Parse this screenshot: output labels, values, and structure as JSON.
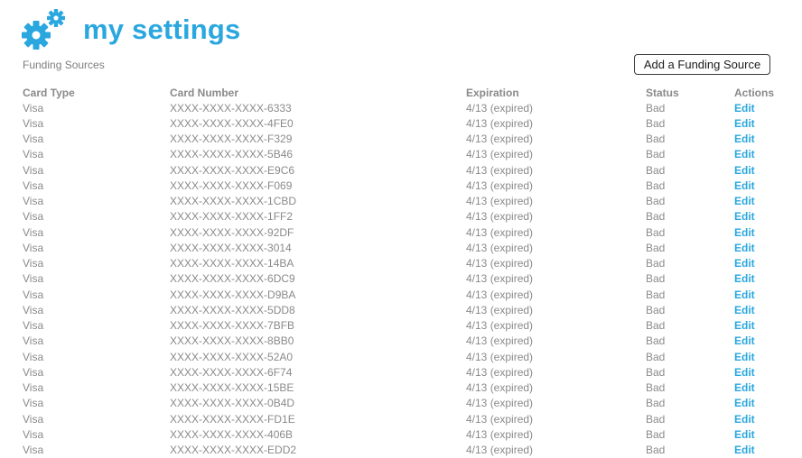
{
  "header": {
    "title": "my settings",
    "subtitle": "Funding Sources",
    "logo_icon": "gears-icon"
  },
  "toolbar": {
    "add_label": "Add a Funding Source"
  },
  "table": {
    "columns": [
      "Card Type",
      "Card Number",
      "Expiration",
      "Status",
      "Actions"
    ],
    "rows": [
      {
        "type": "Visa",
        "number": "XXXX-XXXX-XXXX-6333",
        "expiration": "4/13 (expired)",
        "status": "Bad",
        "action": "Edit"
      },
      {
        "type": "Visa",
        "number": "XXXX-XXXX-XXXX-4FE0",
        "expiration": "4/13 (expired)",
        "status": "Bad",
        "action": "Edit"
      },
      {
        "type": "Visa",
        "number": "XXXX-XXXX-XXXX-F329",
        "expiration": "4/13 (expired)",
        "status": "Bad",
        "action": "Edit"
      },
      {
        "type": "Visa",
        "number": "XXXX-XXXX-XXXX-5B46",
        "expiration": "4/13 (expired)",
        "status": "Bad",
        "action": "Edit"
      },
      {
        "type": "Visa",
        "number": "XXXX-XXXX-XXXX-E9C6",
        "expiration": "4/13 (expired)",
        "status": "Bad",
        "action": "Edit"
      },
      {
        "type": "Visa",
        "number": "XXXX-XXXX-XXXX-F069",
        "expiration": "4/13 (expired)",
        "status": "Bad",
        "action": "Edit"
      },
      {
        "type": "Visa",
        "number": "XXXX-XXXX-XXXX-1CBD",
        "expiration": "4/13 (expired)",
        "status": "Bad",
        "action": "Edit"
      },
      {
        "type": "Visa",
        "number": "XXXX-XXXX-XXXX-1FF2",
        "expiration": "4/13 (expired)",
        "status": "Bad",
        "action": "Edit"
      },
      {
        "type": "Visa",
        "number": "XXXX-XXXX-XXXX-92DF",
        "expiration": "4/13 (expired)",
        "status": "Bad",
        "action": "Edit"
      },
      {
        "type": "Visa",
        "number": "XXXX-XXXX-XXXX-3014",
        "expiration": "4/13 (expired)",
        "status": "Bad",
        "action": "Edit"
      },
      {
        "type": "Visa",
        "number": "XXXX-XXXX-XXXX-14BA",
        "expiration": "4/13 (expired)",
        "status": "Bad",
        "action": "Edit"
      },
      {
        "type": "Visa",
        "number": "XXXX-XXXX-XXXX-6DC9",
        "expiration": "4/13 (expired)",
        "status": "Bad",
        "action": "Edit"
      },
      {
        "type": "Visa",
        "number": "XXXX-XXXX-XXXX-D9BA",
        "expiration": "4/13 (expired)",
        "status": "Bad",
        "action": "Edit"
      },
      {
        "type": "Visa",
        "number": "XXXX-XXXX-XXXX-5DD8",
        "expiration": "4/13 (expired)",
        "status": "Bad",
        "action": "Edit"
      },
      {
        "type": "Visa",
        "number": "XXXX-XXXX-XXXX-7BFB",
        "expiration": "4/13 (expired)",
        "status": "Bad",
        "action": "Edit"
      },
      {
        "type": "Visa",
        "number": "XXXX-XXXX-XXXX-8BB0",
        "expiration": "4/13 (expired)",
        "status": "Bad",
        "action": "Edit"
      },
      {
        "type": "Visa",
        "number": "XXXX-XXXX-XXXX-52A0",
        "expiration": "4/13 (expired)",
        "status": "Bad",
        "action": "Edit"
      },
      {
        "type": "Visa",
        "number": "XXXX-XXXX-XXXX-6F74",
        "expiration": "4/13 (expired)",
        "status": "Bad",
        "action": "Edit"
      },
      {
        "type": "Visa",
        "number": "XXXX-XXXX-XXXX-15BE",
        "expiration": "4/13 (expired)",
        "status": "Bad",
        "action": "Edit"
      },
      {
        "type": "Visa",
        "number": "XXXX-XXXX-XXXX-0B4D",
        "expiration": "4/13 (expired)",
        "status": "Bad",
        "action": "Edit"
      },
      {
        "type": "Visa",
        "number": "XXXX-XXXX-XXXX-FD1E",
        "expiration": "4/13 (expired)",
        "status": "Bad",
        "action": "Edit"
      },
      {
        "type": "Visa",
        "number": "XXXX-XXXX-XXXX-406B",
        "expiration": "4/13 (expired)",
        "status": "Bad",
        "action": "Edit"
      },
      {
        "type": "Visa",
        "number": "XXXX-XXXX-XXXX-EDD2",
        "expiration": "4/13 (expired)",
        "status": "Bad",
        "action": "Edit"
      }
    ]
  },
  "colors": {
    "accent": "#2aa7df",
    "text": "#8a8a8a"
  }
}
